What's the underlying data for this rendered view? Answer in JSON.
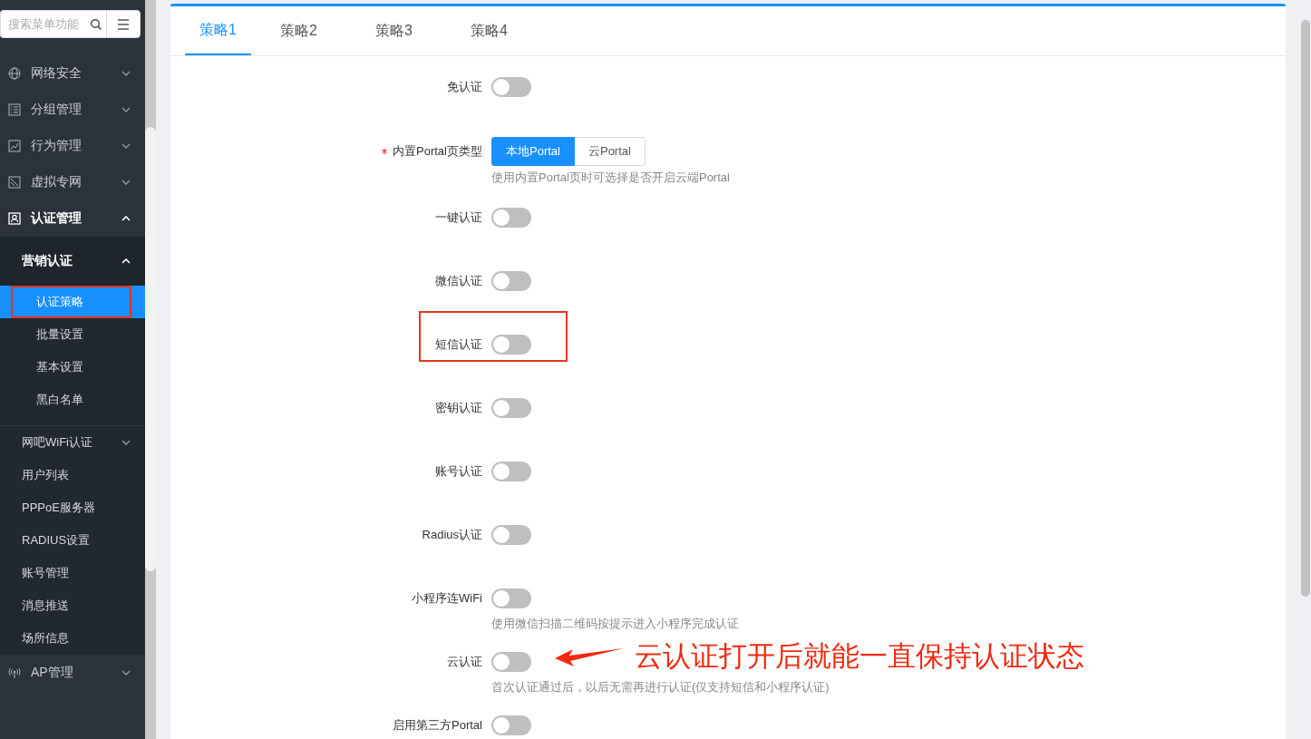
{
  "sidebar": {
    "search": {
      "placeholder": "搜索菜单功能"
    },
    "items": [
      {
        "label": "网络安全",
        "expanded": false
      },
      {
        "label": "分组管理",
        "expanded": false
      },
      {
        "label": "行为管理",
        "expanded": false
      },
      {
        "label": "虚拟专网",
        "expanded": false
      },
      {
        "label": "认证管理",
        "expanded": true,
        "children": [
          {
            "label": "营销认证",
            "expanded": true,
            "children": [
              {
                "label": "认证策略",
                "selected": true,
                "highlighted": true
              },
              {
                "label": "批量设置",
                "selected": false,
                "highlighted": false
              },
              {
                "label": "基本设置",
                "selected": false,
                "highlighted": false
              },
              {
                "label": "黑白名单",
                "selected": false,
                "highlighted": false
              }
            ]
          },
          {
            "label": "网吧WiFi认证",
            "expanded": false
          },
          {
            "label": "用户列表"
          },
          {
            "label": "PPPoE服务器"
          },
          {
            "label": "RADIUS设置"
          },
          {
            "label": "账号管理"
          },
          {
            "label": "消息推送"
          },
          {
            "label": "场所信息"
          }
        ]
      },
      {
        "label": "AP管理",
        "expanded": false
      }
    ]
  },
  "tabs": [
    {
      "label": "策略1",
      "selected": true
    },
    {
      "label": "策略2",
      "selected": false
    },
    {
      "label": "策略3",
      "selected": false
    },
    {
      "label": "策略4",
      "selected": false
    }
  ],
  "form": [
    {
      "kind": "switch",
      "label": "免认证",
      "on": false,
      "highlighted": false
    },
    {
      "kind": "segmented",
      "label": "内置Portal页类型",
      "required": true,
      "options": [
        {
          "label": "本地Portal",
          "selected": true
        },
        {
          "label": "云Portal",
          "selected": false
        }
      ],
      "hint": "使用内置Portal页时可选择是否开启云端Portal",
      "highlighted": false
    },
    {
      "kind": "switch",
      "label": "一键认证",
      "on": false,
      "highlighted": false
    },
    {
      "kind": "switch",
      "label": "微信认证",
      "on": false,
      "highlighted": false
    },
    {
      "kind": "switch",
      "label": "短信认证",
      "on": false,
      "highlighted": true
    },
    {
      "kind": "switch",
      "label": "密钥认证",
      "on": false,
      "highlighted": false
    },
    {
      "kind": "switch",
      "label": "账号认证",
      "on": false,
      "highlighted": false
    },
    {
      "kind": "switch",
      "label": "Radius认证",
      "on": false,
      "highlighted": false
    },
    {
      "kind": "switch",
      "label": "小程序连WiFi",
      "on": false,
      "hint": "使用微信扫描二维码按提示进入小程序完成认证",
      "highlighted": false
    },
    {
      "kind": "switch",
      "label": "云认证",
      "on": false,
      "hint": "首次认证通过后，以后无需再进行认证(仅支持短信和小程序认证)",
      "annotation": "云认证打开后就能一直保持认证状态",
      "highlighted": false
    },
    {
      "kind": "switch",
      "label": "启用第三方Portal",
      "on": false,
      "highlighted": false
    }
  ]
}
